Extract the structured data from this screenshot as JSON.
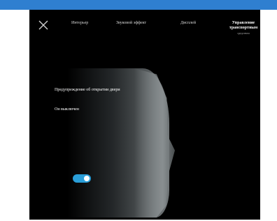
{
  "header": {
    "tabs": [
      {
        "label": "Интерьер"
      },
      {
        "label": "Звуковой эффект"
      },
      {
        "label": "Дисплей"
      },
      {
        "label": "Управление транспортным",
        "sub": "средством"
      }
    ]
  },
  "panel": {
    "warning_label": "Предупреждение об открытии двери",
    "mode_label": "Он выключен"
  },
  "toggle": {
    "on": true
  },
  "colors": {
    "accent": "#2a9ed8",
    "top_bar": "#2f7fd0",
    "background": "#000000"
  },
  "icons": {
    "close": "close-icon"
  }
}
